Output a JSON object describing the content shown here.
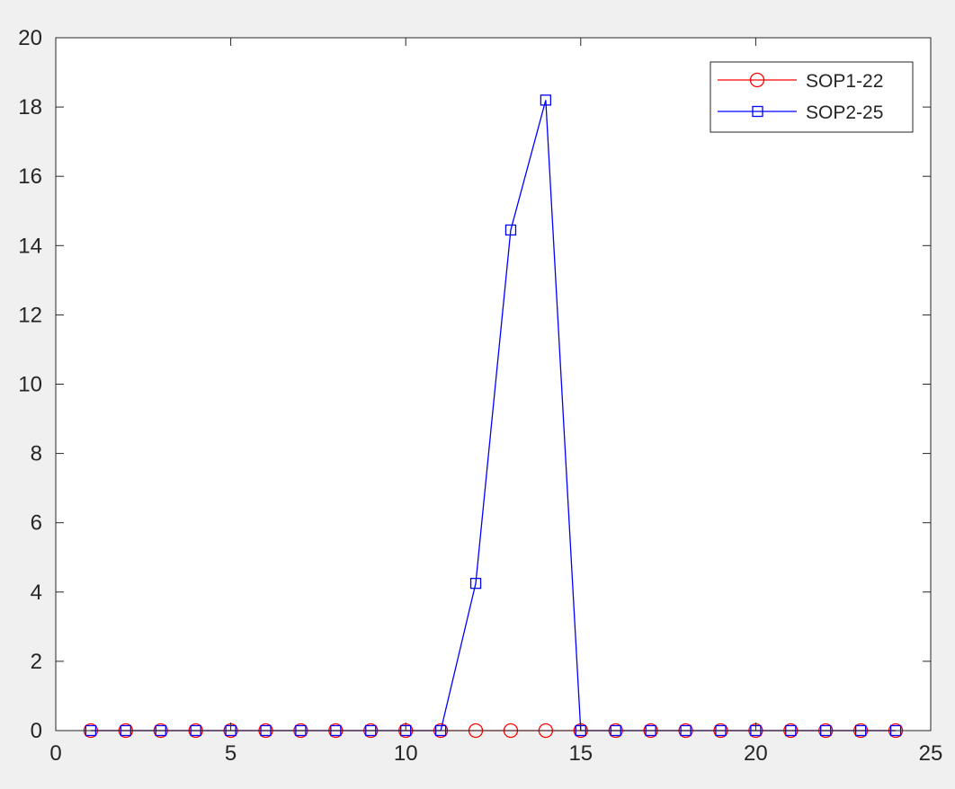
{
  "chart_data": {
    "type": "line",
    "title": "",
    "xlabel": "",
    "ylabel": "",
    "xlim": [
      0,
      25
    ],
    "ylim": [
      0,
      20
    ],
    "xticks": [
      0,
      5,
      10,
      15,
      20,
      25
    ],
    "yticks": [
      0,
      2,
      4,
      6,
      8,
      10,
      12,
      14,
      16,
      18,
      20
    ],
    "grid": false,
    "legend_position": "top-right",
    "x": [
      1,
      2,
      3,
      4,
      5,
      6,
      7,
      8,
      9,
      10,
      11,
      12,
      13,
      14,
      15,
      16,
      17,
      18,
      19,
      20,
      21,
      22,
      23,
      24
    ],
    "series": [
      {
        "name": "SOP1-22",
        "color": "#ff0000",
        "marker": "circle",
        "values": [
          0,
          0,
          0,
          0,
          0,
          0,
          0,
          0,
          0,
          0,
          0,
          0,
          0,
          0,
          0,
          0,
          0,
          0,
          0,
          0,
          0,
          0,
          0,
          0
        ]
      },
      {
        "name": "SOP2-25",
        "color": "#0000ff",
        "marker": "square",
        "values": [
          0,
          0,
          0,
          0,
          0,
          0,
          0,
          0,
          0,
          0,
          0,
          4.25,
          14.45,
          18.2,
          0,
          0,
          0,
          0,
          0,
          0,
          0,
          0,
          0,
          0
        ]
      }
    ]
  }
}
